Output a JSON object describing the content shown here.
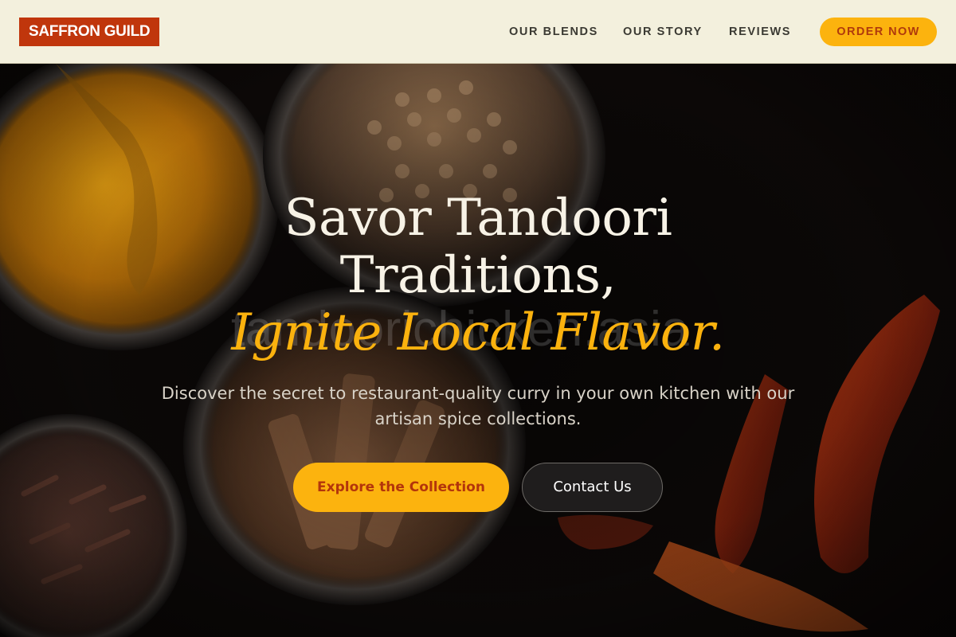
{
  "header": {
    "logo_text": "SAFFRON GUILD",
    "nav": [
      {
        "label": "OUR BLENDS"
      },
      {
        "label": "OUR STORY"
      },
      {
        "label": "REVIEWS"
      }
    ],
    "cta_label": "ORDER NOW"
  },
  "hero": {
    "headline_line1": "Savor Tandoori",
    "headline_line2": "Traditions,",
    "headline_accent": "Ignite Local Flavor.",
    "watermark": "tandoorichicken.asia",
    "subhead": "Discover the secret to restaurant-quality curry in your own kitchen with our artisan spice collections.",
    "primary_button": "Explore the Collection",
    "secondary_button": "Contact Us",
    "background": "spice-bowls-photo"
  },
  "colors": {
    "header_bg": "#f3f0dd",
    "brand_red": "#c0360c",
    "accent_yellow": "#fcb30e",
    "headline_text": "#f7f2e6",
    "dark_bg": "#0b0706"
  }
}
